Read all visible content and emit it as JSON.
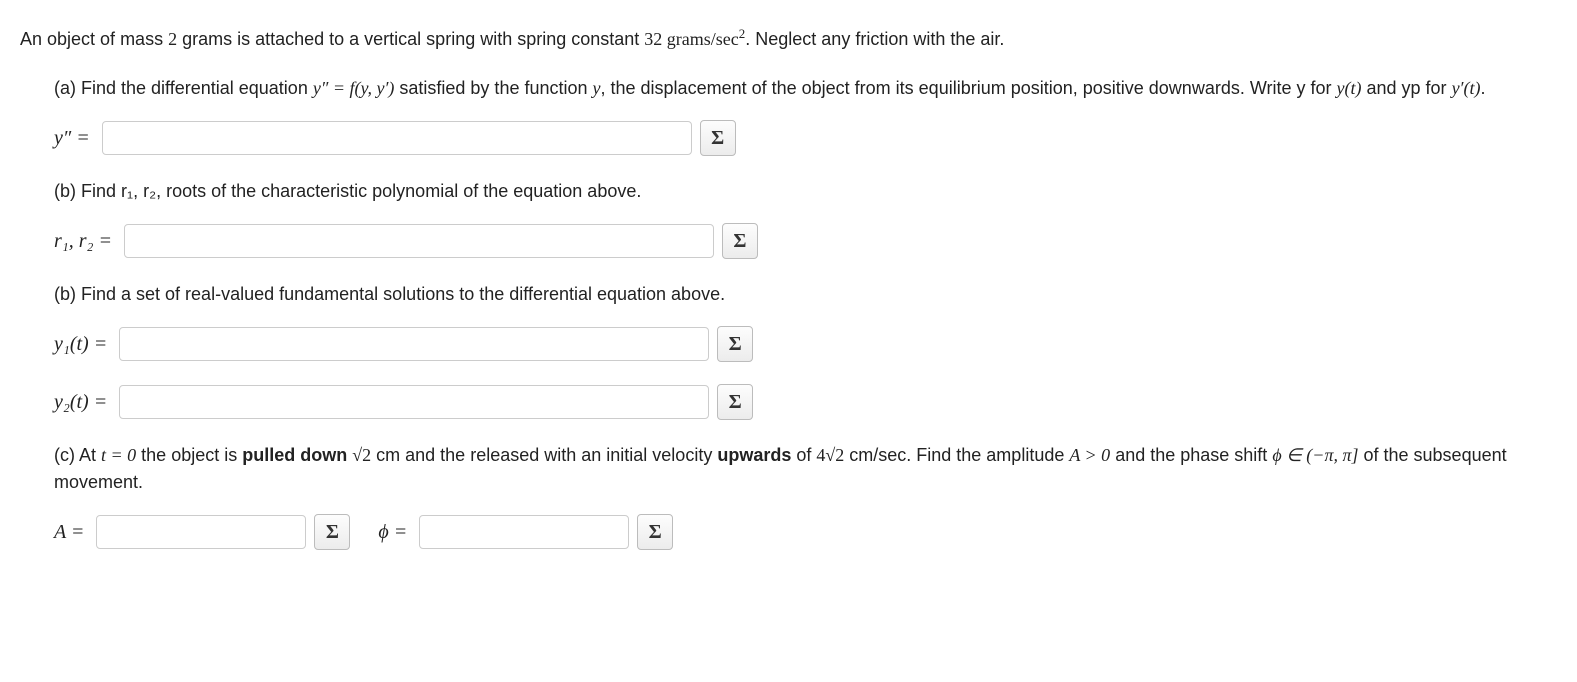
{
  "intro": {
    "t1": "An object of mass ",
    "mass": "2",
    "t2": " grams is attached to a vertical spring with spring constant ",
    "k": "32",
    "units_prefix": " grams/sec",
    "units_sup": "2",
    "t3": ". Neglect any friction with the air."
  },
  "a": {
    "t1": "(a) Find the differential equation ",
    "eq1": "y″ = f(y, y′)",
    "t2": " satisfied by the function ",
    "yvar": "y",
    "t3": ", the displacement of the object from its equilibrium position, positive downwards. Write y for ",
    "yt": "y(t)",
    "t4": " and yp for ",
    "ypt": "y′(t)",
    "t5": "."
  },
  "labels": {
    "ypp": "y″ =",
    "r1r2": "r₁, r₂ =",
    "y1t": "y₁(t) =",
    "y2t": "y₂(t) =",
    "A": "A =",
    "phi": "ϕ ="
  },
  "b1": "(b) Find r₁, r₂, roots of the characteristic polynomial of the equation above.",
  "b2": "(b) Find a set of real-valued fundamental solutions to the differential equation above.",
  "c": {
    "t1": "(c) At ",
    "t0": "t = 0",
    "t2": " the object is ",
    "bold1": "pulled down",
    "t3": " ",
    "sqrt2": "√2",
    "t4": " cm and the released with an initial velocity ",
    "bold2": "upwards",
    "t5": " of ",
    "four": "4",
    "t6": " cm/sec. Find the amplitude ",
    "Agt": "A > 0",
    "t7": " and the phase shift ",
    "phiin": "ϕ ∈ (−π, π]",
    "t8": " of the subsequent movement."
  },
  "sigma": "Σ"
}
